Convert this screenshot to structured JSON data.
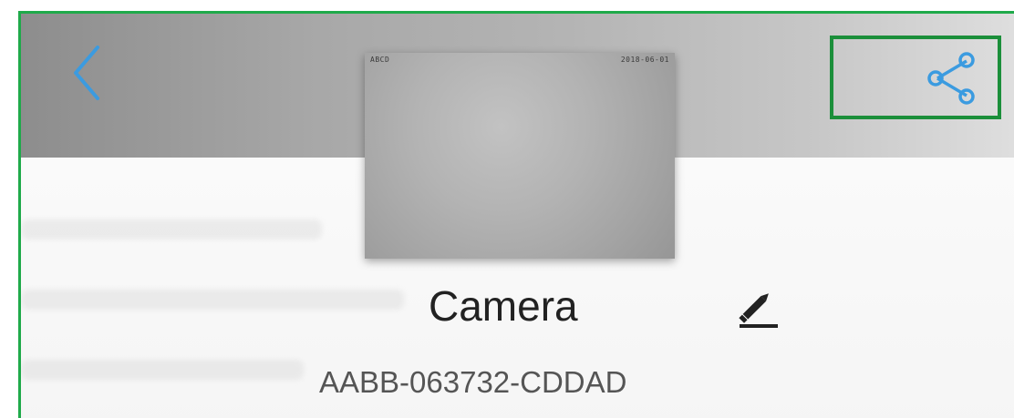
{
  "header": {
    "back_icon": "chevron-left-icon",
    "share_icon": "share-icon"
  },
  "thumbnail": {
    "caption_left": "ABCD",
    "caption_right": "2018-06-01"
  },
  "device": {
    "name": "Camera",
    "id": "AABB-063732-CDDAD",
    "edit_icon": "pencil-icon"
  },
  "colors": {
    "accent": "#3b9be0",
    "highlight": "#1b8f3a",
    "frame": "#1faa4a"
  }
}
